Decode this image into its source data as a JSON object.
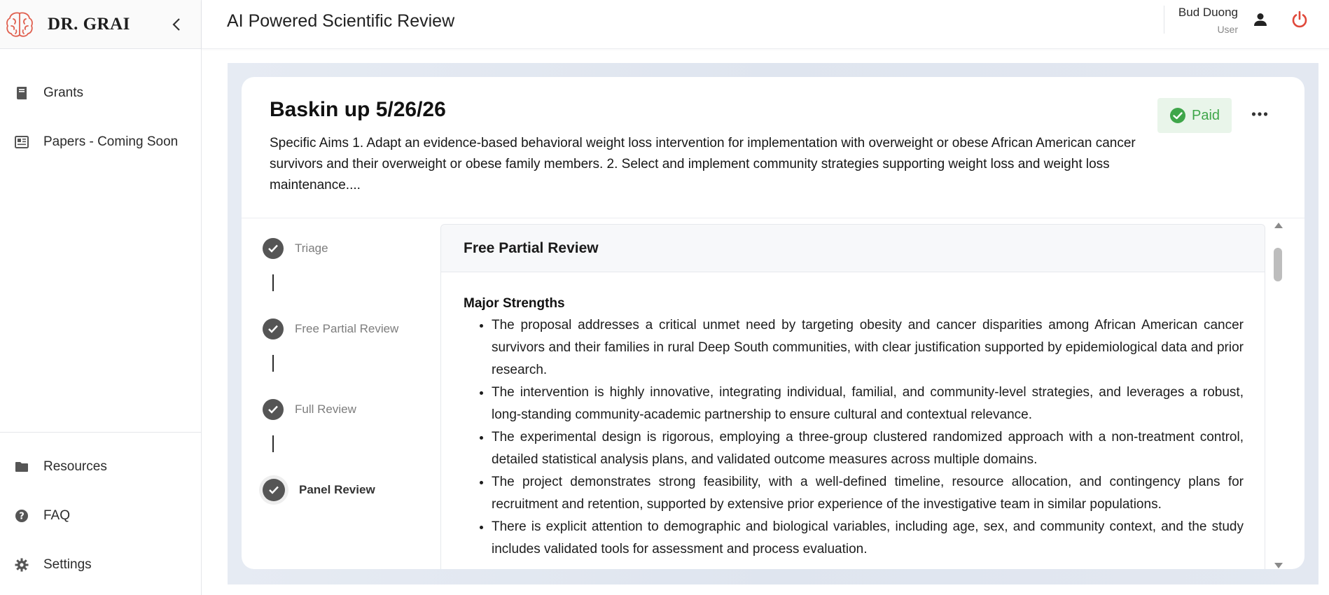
{
  "app": {
    "brand": "DR. GRAI",
    "header_title": "AI Powered Scientific Review"
  },
  "sidebar": {
    "items": [
      {
        "label": "Grants",
        "icon": "book-icon"
      },
      {
        "label": "Papers - Coming Soon",
        "icon": "newspaper-icon"
      }
    ],
    "bottom_items": [
      {
        "label": "Resources",
        "icon": "folder-icon"
      },
      {
        "label": "FAQ",
        "icon": "help-icon"
      },
      {
        "label": "Settings",
        "icon": "gear-icon"
      }
    ]
  },
  "user": {
    "name": "Bud Duong",
    "role": "User"
  },
  "grant": {
    "title": "Baskin up 5/26/26",
    "description": "Specific Aims 1. Adapt an evidence-based behavioral weight loss intervention for implementation with overweight or obese African American cancer survivors and their overweight or obese family members. 2. Select and implement community strategies supporting weight loss and weight loss maintenance....",
    "status": "Paid"
  },
  "steps": [
    {
      "label": "Triage"
    },
    {
      "label": "Free Partial Review"
    },
    {
      "label": "Full Review"
    },
    {
      "label": "Panel Review",
      "active": true
    }
  ],
  "review": {
    "title": "Free Partial Review",
    "section_title": "Major Strengths",
    "bullets": [
      "The proposal addresses a critical unmet need by targeting obesity and cancer disparities among African American cancer survivors and their families in rural Deep South communities, with clear justification supported by epidemiological data and prior research.",
      "The intervention is highly innovative, integrating individual, familial, and community-level strategies, and leverages a robust, long-standing community-academic partnership to ensure cultural and contextual relevance.",
      "The experimental design is rigorous, employing a three-group clustered randomized approach with a non-treatment control, detailed statistical analysis plans, and validated outcome measures across multiple domains.",
      "The project demonstrates strong feasibility, with a well-defined timeline, resource allocation, and contingency plans for recruitment and retention, supported by extensive prior experience of the investigative team in similar populations.",
      "There is explicit attention to demographic and biological variables, including age, sex, and community context, and the study includes validated tools for assessment and process evaluation."
    ]
  },
  "colors": {
    "accent_red": "#e0483a",
    "paid_green": "#3fa64a",
    "step_gray": "#555555"
  }
}
